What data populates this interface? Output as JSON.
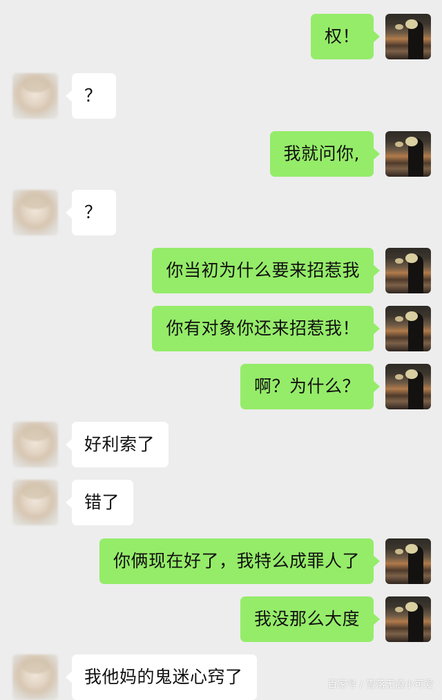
{
  "chat": {
    "messages": [
      {
        "side": "sent",
        "text": "权！"
      },
      {
        "side": "received",
        "text": "？"
      },
      {
        "side": "sent",
        "text": "我就问你,"
      },
      {
        "side": "received",
        "text": "？"
      },
      {
        "side": "sent",
        "text": "你当初为什么要来招惹我"
      },
      {
        "side": "sent",
        "text": "你有对象你还来招惹我！"
      },
      {
        "side": "sent",
        "text": "啊？为什么？"
      },
      {
        "side": "received",
        "text": "好利索了"
      },
      {
        "side": "received",
        "text": "错了"
      },
      {
        "side": "sent",
        "text": "你俩现在好了，我特么成罪人了"
      },
      {
        "side": "sent",
        "text": "我没那么大度"
      },
      {
        "side": "received",
        "text": "我他妈的鬼迷心窍了"
      }
    ]
  },
  "watermark": "百家号 / 雪落无痕小可爱",
  "colors": {
    "background": "#ededed",
    "sent_bubble": "#95ec69",
    "received_bubble": "#ffffff"
  }
}
